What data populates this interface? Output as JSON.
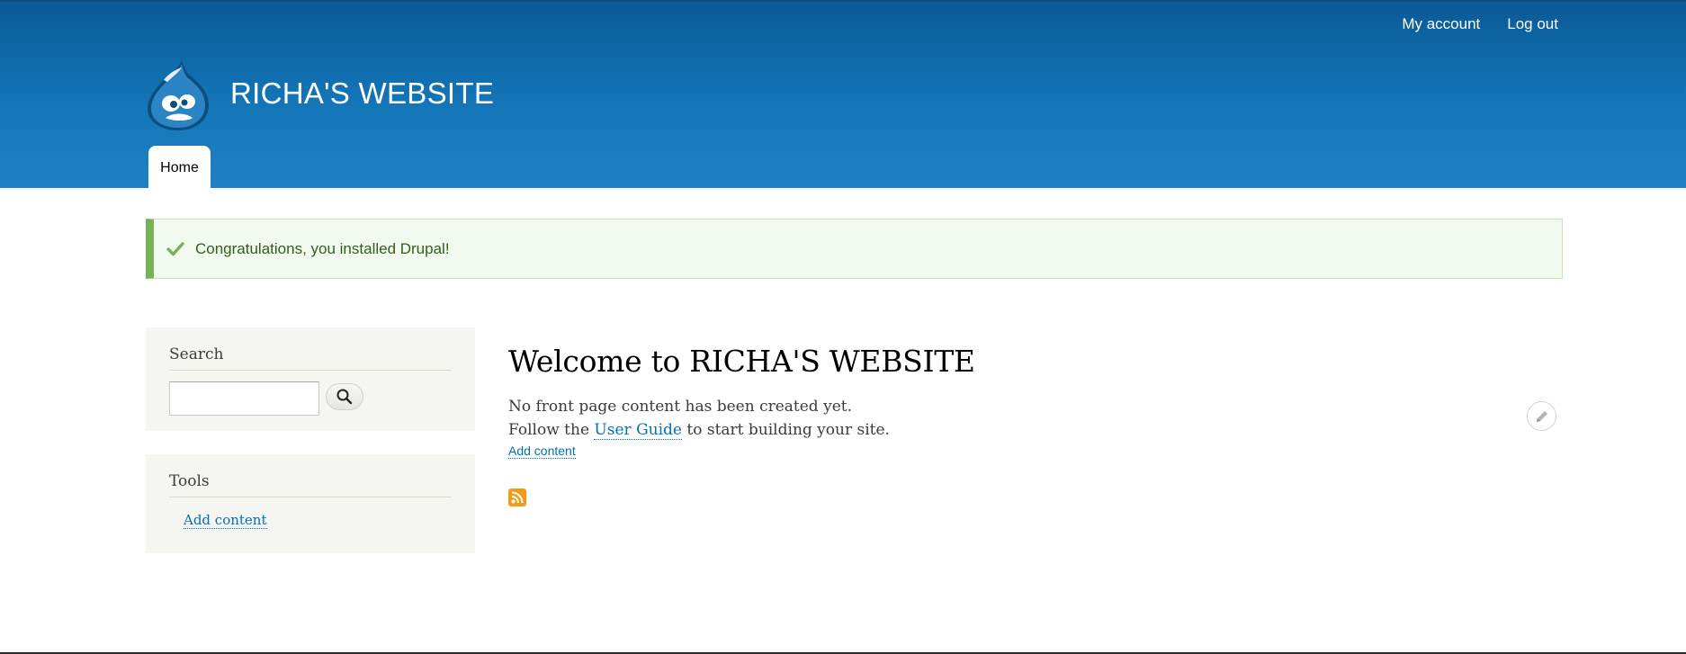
{
  "header": {
    "site_name": "RICHA'S WEBSITE",
    "logo_icon": "drupal-drop-icon",
    "secondary_menu": {
      "my_account": "My account",
      "log_out": "Log out"
    },
    "main_menu": {
      "home": "Home"
    }
  },
  "status_message": {
    "icon": "checkmark-icon",
    "text": "Congratulations, you installed Drupal!"
  },
  "sidebar": {
    "search": {
      "title": "Search",
      "input_value": "",
      "button_icon": "search-icon"
    },
    "tools": {
      "title": "Tools",
      "link": "Add content"
    }
  },
  "main": {
    "title": "Welcome to RICHA'S WEBSITE",
    "line1": "No front page content has been created yet.",
    "line2_prefix": "Follow the",
    "line2_link": "User Guide",
    "line2_suffix": "to start building your site.",
    "add_content": "Add content",
    "feed_icon": "rss-feed-icon",
    "edit_icon": "pencil-icon"
  },
  "colors": {
    "header_dark": "#0a5a96",
    "header_light": "#1e82c4",
    "link": "#0071b3",
    "status_border": "#77b259",
    "status_bg": "#f2faef",
    "feed": "#f39b18"
  }
}
